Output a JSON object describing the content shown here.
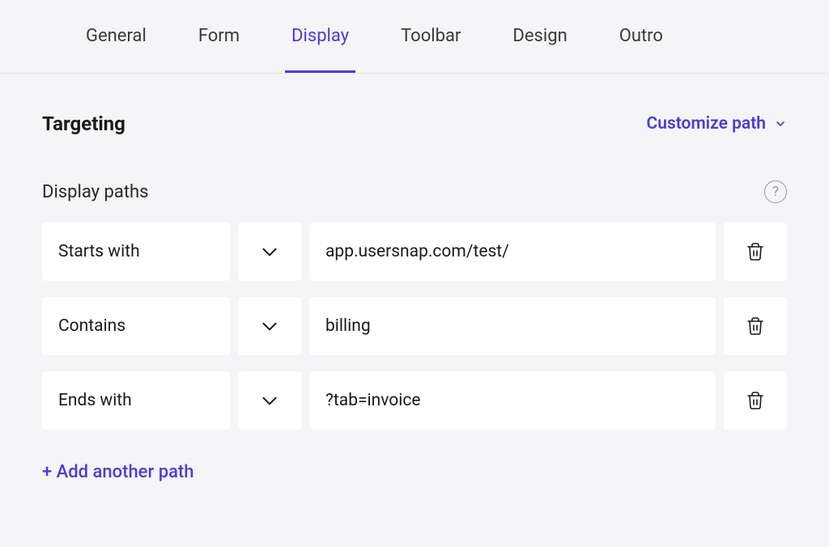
{
  "tabs": [
    {
      "label": "General",
      "active": false
    },
    {
      "label": "Form",
      "active": false
    },
    {
      "label": "Display",
      "active": true
    },
    {
      "label": "Toolbar",
      "active": false
    },
    {
      "label": "Design",
      "active": false
    },
    {
      "label": "Outro",
      "active": false
    }
  ],
  "section": {
    "title": "Targeting",
    "customize_label": "Customize path"
  },
  "subsection": {
    "title": "Display paths"
  },
  "paths": [
    {
      "condition": "Starts with",
      "value": "app.usersnap.com/test/"
    },
    {
      "condition": "Contains",
      "value": "billing"
    },
    {
      "condition": "Ends with",
      "value": "?tab=invoice"
    }
  ],
  "add_label": "+ Add another path"
}
